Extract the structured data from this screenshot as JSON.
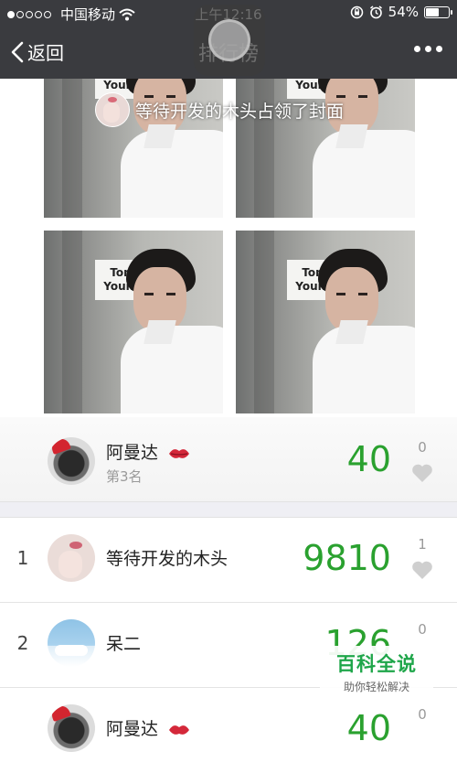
{
  "status_bar": {
    "carrier": "中国移动",
    "time": "上午12:16",
    "battery": "54%",
    "battery_level": 0.54
  },
  "nav": {
    "back_label": "返回",
    "title": "排行榜"
  },
  "cover": {
    "banner_text": "等待开发的木头占领了封面",
    "photo_sign_line1": "Tom",
    "photo_sign_line2": "Young"
  },
  "my_rank": {
    "name": "阿曼达",
    "rank_label": "第3名",
    "score": "40",
    "likes": "0"
  },
  "ranking": [
    {
      "rank": "1",
      "name": "等待开发的木头",
      "score": "9810",
      "likes": "1"
    },
    {
      "rank": "2",
      "name": "呆二",
      "score": "126",
      "likes": "0"
    },
    {
      "rank": "",
      "name": "阿曼达",
      "score": "40",
      "likes": "0"
    }
  ],
  "watermark": {
    "title": "百科全说",
    "subtitle": "助你轻松解决"
  },
  "colors": {
    "score_green": "#2aa12f",
    "nav_bg": "#3a3b3f"
  }
}
